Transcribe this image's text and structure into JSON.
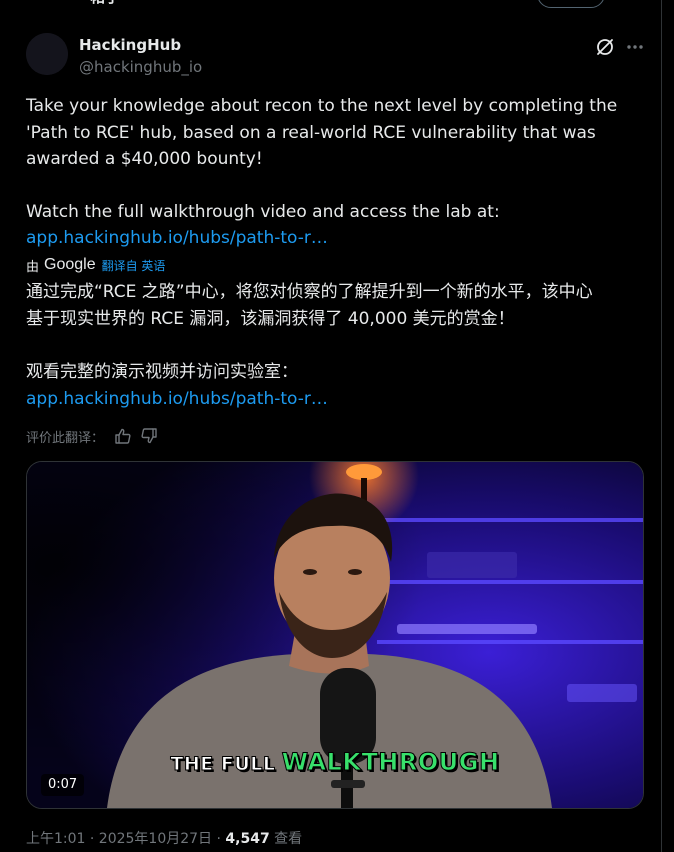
{
  "top": {
    "partial_title": "帖子"
  },
  "author": {
    "name": "HackingHub",
    "handle": "@hackinghub_io"
  },
  "post": {
    "lines": [
      "Take your knowledge about recon to the next level by completing the",
      "'Path to RCE' hub, based on a real-world RCE vulnerability that was",
      "awarded a $40,000 bounty!"
    ],
    "line2": "Watch the full walkthrough video and access the lab at:",
    "link": "app.hackinghub.io/hubs/path-to-r…"
  },
  "translation": {
    "by": "由",
    "google": "Google",
    "from": "翻译自 英语",
    "lines": [
      "通过完成“RCE 之路”中心，将您对侦察的了解提升到一个新的水平，该中心",
      "基于现实世界的 RCE 漏洞，该漏洞获得了 40,000 美元的赏金！"
    ],
    "line2": "观看完整的演示视频并访问实验室：",
    "link": "app.hackinghub.io/hubs/path-to-r…"
  },
  "rate": {
    "label": "评价此翻译："
  },
  "video": {
    "caption_white": "THE FULL",
    "caption_green": "WALKTHROUGH",
    "time": "0:07",
    "colors": {
      "caption_green": "#38e06b",
      "ambient": "#3b1fd6"
    }
  },
  "meta": {
    "datetime": "上午1:01 · 2025年10月27日 · ",
    "views": "4,547",
    "views_label": " 查看"
  },
  "icons": {
    "grok": "grok-icon",
    "more": "more-icon",
    "like": "thumbs-up-icon",
    "dislike": "thumbs-down-icon"
  },
  "colors": {
    "link": "#1d9bf0",
    "text": "#e7e9ea",
    "muted": "#71767b",
    "background": "#000000"
  }
}
